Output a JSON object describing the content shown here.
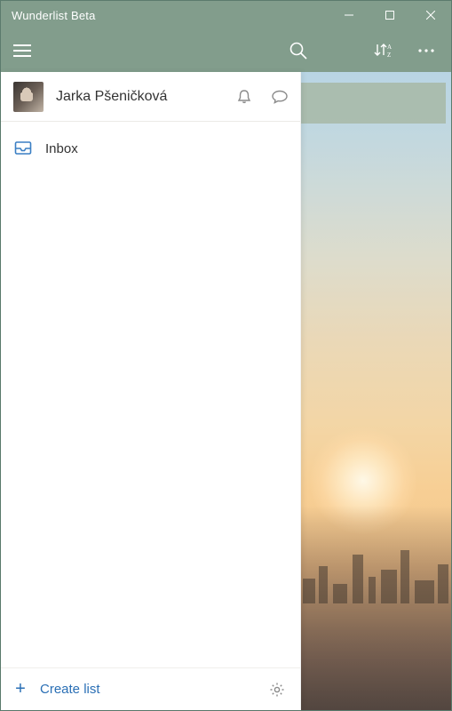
{
  "window": {
    "title": "Wunderlist Beta"
  },
  "profile": {
    "name": "Jarka Pšeničková"
  },
  "lists": [
    {
      "icon": "inbox",
      "label": "Inbox"
    }
  ],
  "footer": {
    "create_label": "Create list"
  }
}
